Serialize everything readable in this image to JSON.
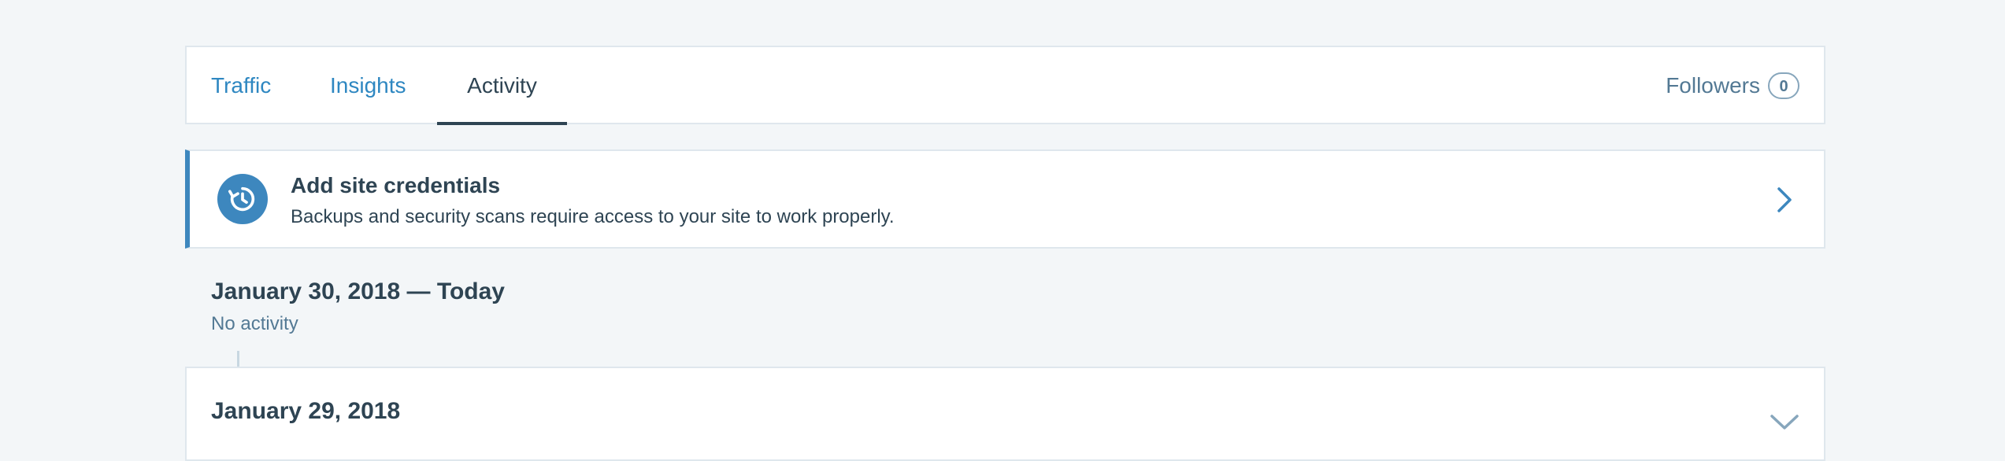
{
  "section_nav": {
    "tabs": [
      {
        "label": "Traffic"
      },
      {
        "label": "Insights"
      },
      {
        "label": "Activity"
      }
    ],
    "selected_tab": "Activity",
    "followers": {
      "label": "Followers",
      "count": "0"
    }
  },
  "banner": {
    "icon": "history-icon",
    "title": "Add site credentials",
    "description": "Backups and security scans require access to your site to work properly.",
    "action_icon": "chevron-right-icon",
    "accent_color": "#3d87be"
  },
  "activity_days": [
    {
      "title": "January 30, 2018 — Today",
      "subtitle": "No activity"
    },
    {
      "title": "January 29, 2018",
      "toggle_icon": "chevron-down-icon"
    }
  ],
  "colors": {
    "link": "#2e87c1",
    "text": "#2e4453",
    "muted": "#537994",
    "border": "#dfe7ed",
    "background": "#f3f6f8"
  }
}
